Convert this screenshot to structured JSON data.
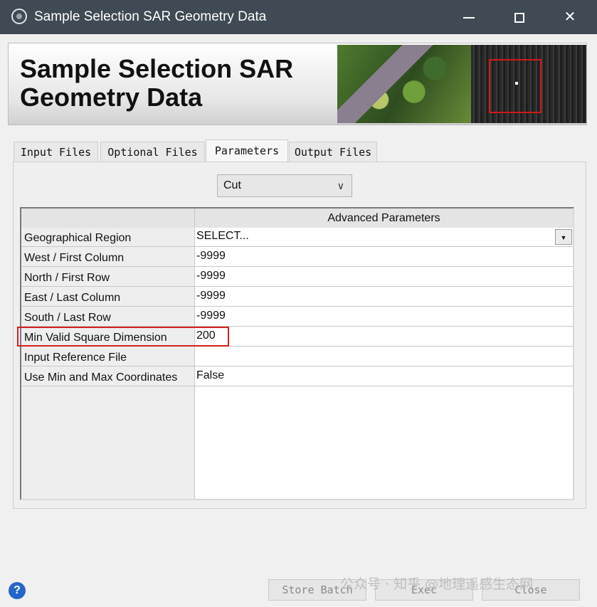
{
  "window": {
    "title": "Sample Selection SAR Geometry Data",
    "controls": {
      "minimize": "",
      "maximize": "",
      "close": "✕"
    }
  },
  "banner": {
    "title": "Sample Selection SAR\nGeometry Data"
  },
  "tabs": [
    {
      "label": "Input Files",
      "active": false
    },
    {
      "label": "Optional Files",
      "active": false
    },
    {
      "label": "Parameters",
      "active": true
    },
    {
      "label": "Output Files",
      "active": false
    }
  ],
  "mode_select": {
    "value": "Cut"
  },
  "params_table": {
    "header": "Advanced Parameters",
    "rows": [
      {
        "name": "Geographical Region",
        "value": "SELECT..."
      },
      {
        "name": "West / First Column",
        "value": "-9999"
      },
      {
        "name": "North / First Row",
        "value": "-9999"
      },
      {
        "name": "East / Last Column",
        "value": "-9999"
      },
      {
        "name": "South / Last Row",
        "value": "-9999"
      },
      {
        "name": "Min Valid Square Dimension",
        "value": "200"
      },
      {
        "name": "Input Reference File",
        "value": ""
      },
      {
        "name": "Use Min and Max Coordinates",
        "value": "False"
      }
    ],
    "highlight_color": "#d42020"
  },
  "bottom": {
    "help_icon": "?",
    "store_batch_label": "Store Batch",
    "exec_label": "Exec",
    "close_label": "Close",
    "watermark": "公众号 · 知乎 @地理遥感生态网"
  },
  "colors": {
    "titlebar": "#3f4a54",
    "accent": "#2565c8"
  }
}
